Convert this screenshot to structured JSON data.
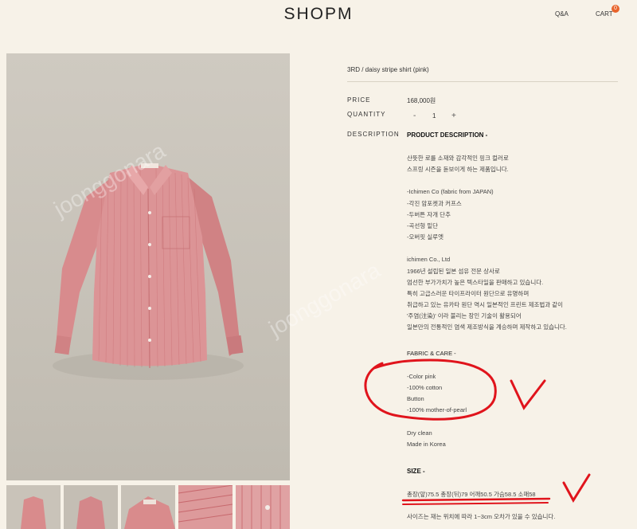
{
  "header": {
    "logo": "SHOPM",
    "qa_label": "Q&A",
    "cart_label": "CART",
    "cart_count": "0"
  },
  "product": {
    "title": "3RD / daisy stripe shirt (pink)",
    "price_label": "PRICE",
    "price": "168,000원",
    "quantity_label": "QUANTITY",
    "quantity_minus": "-",
    "quantity": "1",
    "quantity_plus": "+",
    "description_label": "DESCRIPTION",
    "description_head": "PRODUCT DESCRIPTION -",
    "intro": [
      "산뜻한 로를 소재와 감각적인 핑크 컬러로",
      "스프링 시즌을 돋보이게 하는 제품입니다."
    ],
    "features": [
      "-Ichimen Co (fabric from JAPAN)",
      "-각진 암포켓과 커프스",
      "-두버튼 자개 단추",
      "-곡선형 밑단",
      "-오버핏 실루엣"
    ],
    "maker": [
      "ichimen Co., Ltd",
      "1966년 설립된 일본 섬유 전문 상사로",
      "엄선한 부가가치가 높은 텍스타일을 판매하고 있습니다.",
      "특히 고급스러운 타이프라이터 원단으로 유명하며",
      "취급하고 있는 유카타 원단 역시 일본적인 프린트 제조법과 같이",
      "'주염(注染)' 이라 불리는 장인 기술이 활용되어",
      "일본만의 전통적인 염색 제조방식을 계승하며 제작하고 있습니다."
    ],
    "fabric_head": "FABRIC & CARE -",
    "fabric": [
      "-Color pink",
      "-100% cotton",
      "Button",
      "-100% mother-of-pearl"
    ],
    "care": [
      "Dry clean",
      "Made in Korea"
    ],
    "size_head": "SIZE -",
    "size_line": "총장(앞)75.5 총장(뒤)79 어깨50.5 가슴58.5 소매58",
    "size_note": "사이즈는 재는 위치에 따라 1~3cm 오차가 있을 수 있습니다."
  },
  "watermark": "joonggonara",
  "colors": {
    "background": "#f7f2e8",
    "shirt": "#d98b8c",
    "annotation": "#e0141c",
    "badge": "#e8642c"
  }
}
